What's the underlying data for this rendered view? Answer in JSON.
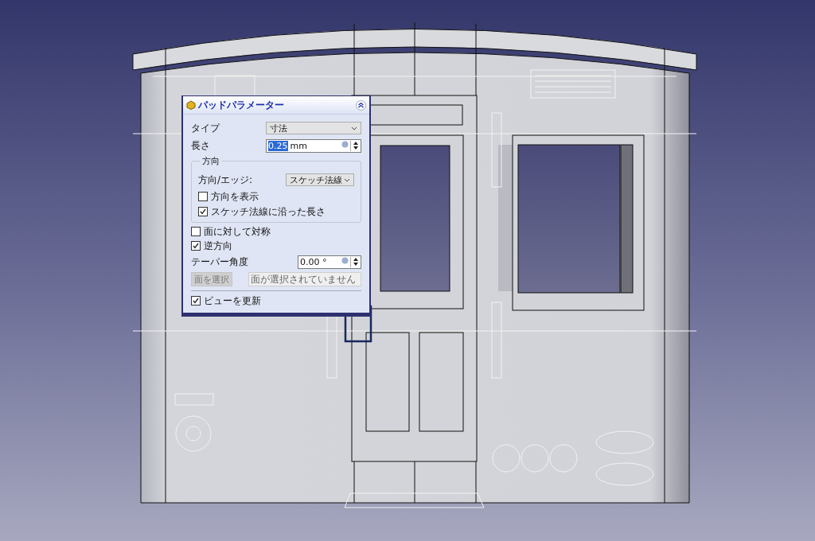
{
  "panel": {
    "title": "パッドパラメーター"
  },
  "type": {
    "label": "タイプ",
    "value": "寸法"
  },
  "length": {
    "label": "長さ",
    "value": "0.25",
    "unit": "mm",
    "selected": true
  },
  "direction": {
    "title": "方向",
    "edge_label": "方向/エッジ:",
    "edge_value": "スケッチ法線",
    "options": [
      {
        "label": "方向を表示",
        "checked": false
      },
      {
        "label": "スケッチ法線に沿った長さ",
        "checked": true
      }
    ]
  },
  "options": [
    {
      "label": "面に対して対称",
      "checked": false
    },
    {
      "label": "逆方向",
      "checked": true
    }
  ],
  "taper": {
    "label": "テーパー角度",
    "value": "0.00 °"
  },
  "face": {
    "button": "面を選択",
    "disabled": true,
    "field": "面が選択されていません"
  },
  "update_view": {
    "label": "ビューを更新",
    "checked": true
  }
}
